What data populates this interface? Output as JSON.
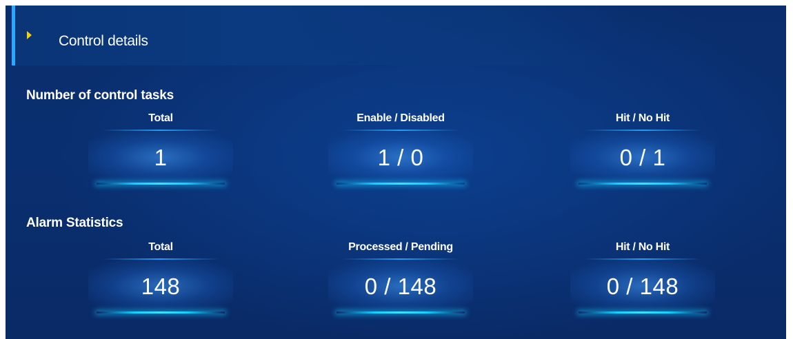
{
  "header": {
    "title": "Control details"
  },
  "sections": [
    {
      "title": "Number of control tasks",
      "stats": [
        {
          "label": "Total",
          "value": "1"
        },
        {
          "label": "Enable / Disabled",
          "value": "1 / 0"
        },
        {
          "label": "Hit / No Hit",
          "value": "0 / 1"
        }
      ]
    },
    {
      "title": "Alarm Statistics",
      "stats": [
        {
          "label": "Total",
          "value": "148"
        },
        {
          "label": "Processed / Pending",
          "value": "0 / 148"
        },
        {
          "label": "Hit / No Hit",
          "value": "0 / 148"
        }
      ]
    }
  ],
  "colors": {
    "background": "#0a2e6d",
    "accent_bar": "#2aa8ff",
    "arrow": "#f6d000",
    "glow_line": "#14d0ff"
  },
  "icons": {
    "header_arrow": "caret-right-icon"
  }
}
